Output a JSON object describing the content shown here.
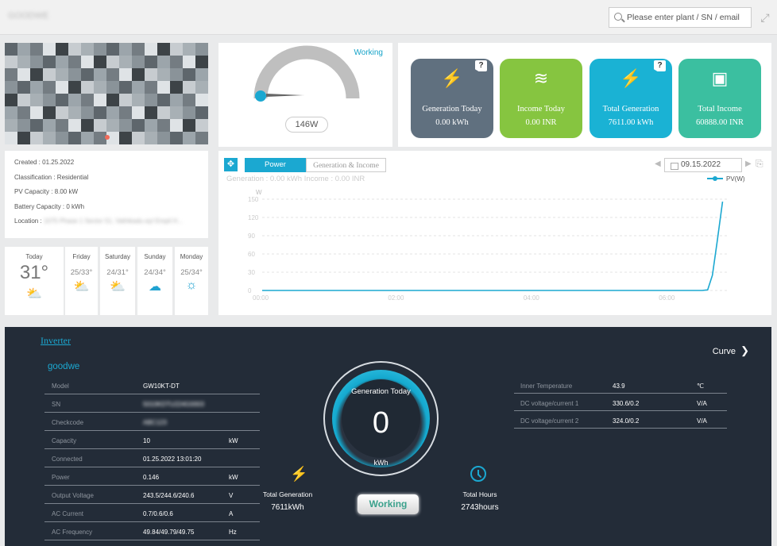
{
  "header": {
    "plant_name": "GOODWE",
    "search_placeholder": "Please enter plant / SN / email"
  },
  "gauge": {
    "status": "Working",
    "value": "146W",
    "level_fraction": 0.01
  },
  "stats": [
    {
      "label": "Generation Today",
      "value": "0.00 kWh",
      "color": "#60707f",
      "icon": "bolt-icon",
      "help": "?"
    },
    {
      "label": "Income Today",
      "value": "0.00 INR",
      "color": "#86c540",
      "icon": "coins-icon",
      "help": ""
    },
    {
      "label": "Total Generation",
      "value": "7611.00 kWh",
      "color": "#1ab2d4",
      "icon": "bolt-icon",
      "help": "?"
    },
    {
      "label": "Total Income",
      "value": "60888.00 INR",
      "color": "#3bbfa0",
      "icon": "money-icon",
      "help": ""
    }
  ],
  "plant_info": {
    "created": "Created : 01.25.2022",
    "classification": "Classification : Residential",
    "pv_capacity": "PV Capacity : 8.00 kW",
    "battery_capacity": "Battery Capacity : 0 kWh",
    "location_label": "Location :",
    "location_value": "1075 Phase 1 Sector 51, Vathikadu-ayl Empil H..."
  },
  "weather": [
    {
      "day": "Today",
      "temp": "31°",
      "icon": "partly-cloudy-icon"
    },
    {
      "day": "Friday",
      "temp": "25/33°",
      "icon": "partly-cloudy-icon"
    },
    {
      "day": "Saturday",
      "temp": "24/31°",
      "icon": "partly-cloudy-icon"
    },
    {
      "day": "Sunday",
      "temp": "24/34°",
      "icon": "rain-cloud-icon"
    },
    {
      "day": "Monday",
      "temp": "25/34°",
      "icon": "sunny-icon"
    }
  ],
  "chart_panel": {
    "tab_power": "Power",
    "tab_gen_income": "Generation & Income",
    "subtitle": "Generation : 0.00 kWh    Income : 0.00 INR",
    "date": "09.15.2022"
  },
  "chart_data": {
    "type": "line",
    "ylabel": "W",
    "ylim": [
      0,
      150
    ],
    "yticks": [
      "0",
      "30",
      "60",
      "90",
      "120",
      "150"
    ],
    "xticks": [
      "00:00",
      "02:00",
      "04:00",
      "06:00"
    ],
    "xlim": [
      0,
      6.9
    ],
    "legend": "top-right",
    "series": [
      {
        "name": "PV(W)",
        "color": "#1ba8d1",
        "x": [
          0,
          6.5,
          6.58,
          6.65,
          6.72,
          6.8
        ],
        "y": [
          0,
          0,
          1,
          25,
          80,
          146
        ]
      }
    ]
  },
  "inverter": {
    "link": "Inverter",
    "brand": "goodwe",
    "curve": "Curve",
    "rows": [
      {
        "k": "Model",
        "v": "GW10KT-DT",
        "u": ""
      },
      {
        "k": "SN",
        "v": "5010KDTU224G0003",
        "u": ""
      },
      {
        "k": "Checkcode",
        "v": "ABC123",
        "u": ""
      },
      {
        "k": "Capacity",
        "v": "10",
        "u": "kW"
      },
      {
        "k": "Connected",
        "v": "01.25.2022 13:01:20",
        "u": ""
      },
      {
        "k": "Power",
        "v": "0.146",
        "u": "kW"
      },
      {
        "k": "Output Voltage",
        "v": "243.5/244.6/240.6",
        "u": "V"
      },
      {
        "k": "AC Current",
        "v": "0.7/0.6/0.6",
        "u": "A"
      },
      {
        "k": "AC Frequency",
        "v": "49.84/49.79/49.75",
        "u": "Hz"
      }
    ],
    "rows_right": [
      {
        "k": "Inner Temperature",
        "v": "43.9",
        "u": "℃"
      },
      {
        "k": "DC voltage/current 1",
        "v": "330.6/0.2",
        "u": "V/A"
      },
      {
        "k": "DC voltage/current 2",
        "v": "324.0/0.2",
        "u": "V/A"
      }
    ],
    "ring_title": "Generation Today",
    "ring_value": "0",
    "ring_unit": "kWh",
    "total_gen_label": "Total Generation",
    "total_gen_value": "7611kWh",
    "status_button": "Working",
    "total_hours_label": "Total Hours",
    "total_hours_value": "2743hours"
  }
}
